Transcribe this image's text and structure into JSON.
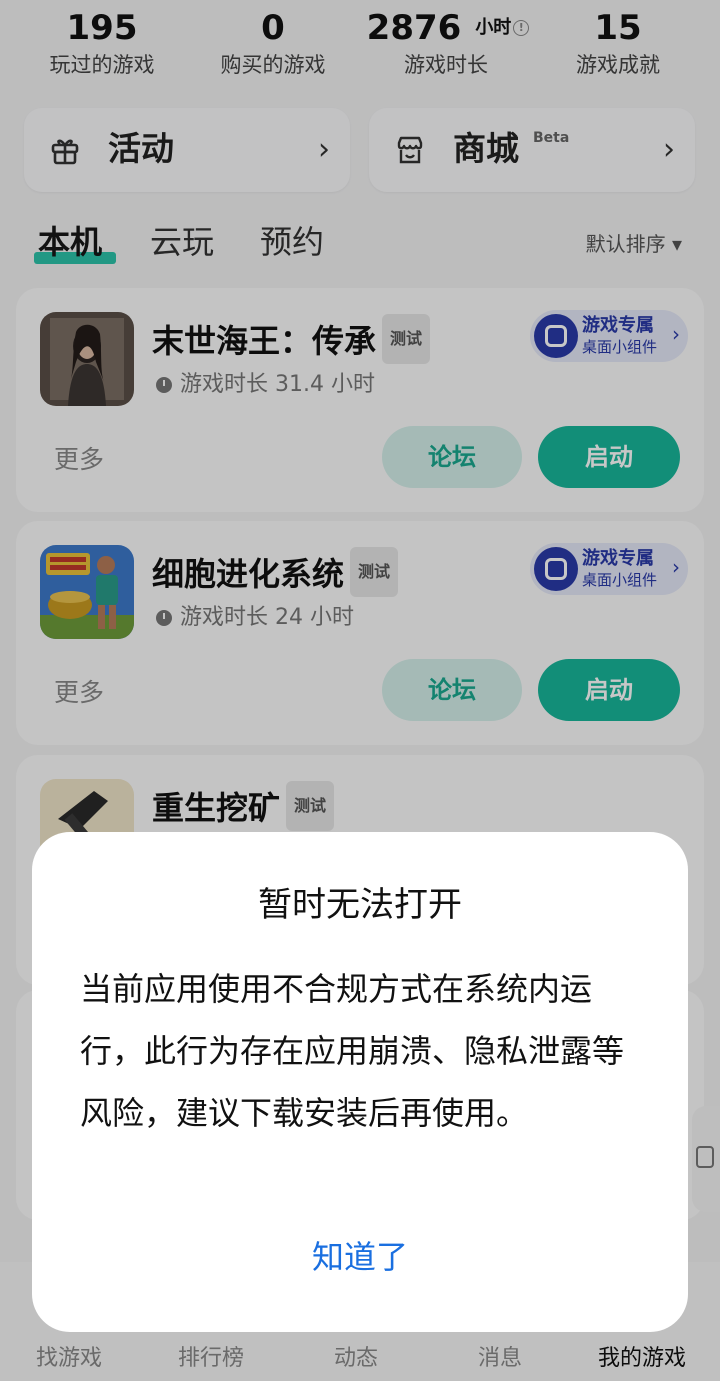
{
  "stats": [
    {
      "value": "195",
      "label": "玩过的游戏"
    },
    {
      "value": "0",
      "label": "购买的游戏"
    },
    {
      "value": "2876",
      "unit": "小时",
      "label": "游戏时长"
    },
    {
      "value": "15",
      "label": "游戏成就"
    }
  ],
  "entries": {
    "activity": {
      "label": "活动",
      "icon": "gift-icon"
    },
    "store": {
      "label": "商城",
      "badge": "Beta",
      "icon": "store-icon"
    }
  },
  "tabs": [
    "本机",
    "云玩",
    "预约"
  ],
  "sort_label": "默认排序 ▾",
  "games": [
    {
      "name": "末世海王：传承",
      "tag": "测试",
      "playtime": "游戏时长 31.4 小时",
      "widget_title": "游戏专属",
      "widget_sub": "桌面小组件",
      "more": "更多",
      "forum": "论坛",
      "launch": "启动"
    },
    {
      "name": "细胞进化系统",
      "tag": "测试",
      "playtime": "游戏时长 24 小时",
      "widget_title": "游戏专属",
      "widget_sub": "桌面小组件",
      "more": "更多",
      "forum": "论坛",
      "launch": "启动"
    },
    {
      "name": "重生挖矿",
      "tag": "测试"
    }
  ],
  "nav": [
    "找游戏",
    "排行榜",
    "动态",
    "消息",
    "我的游戏"
  ],
  "dialog": {
    "title": "暂时无法打开",
    "body": "当前应用使用不合规方式在系统内运行，此行为存在应用崩溃、隐私泄露等风险，建议下载安装后再使用。",
    "button": "知道了"
  },
  "colors": {
    "accent": "#18b79a",
    "dialog_button": "#1a6fe0",
    "widget": "#2a3aa8"
  }
}
